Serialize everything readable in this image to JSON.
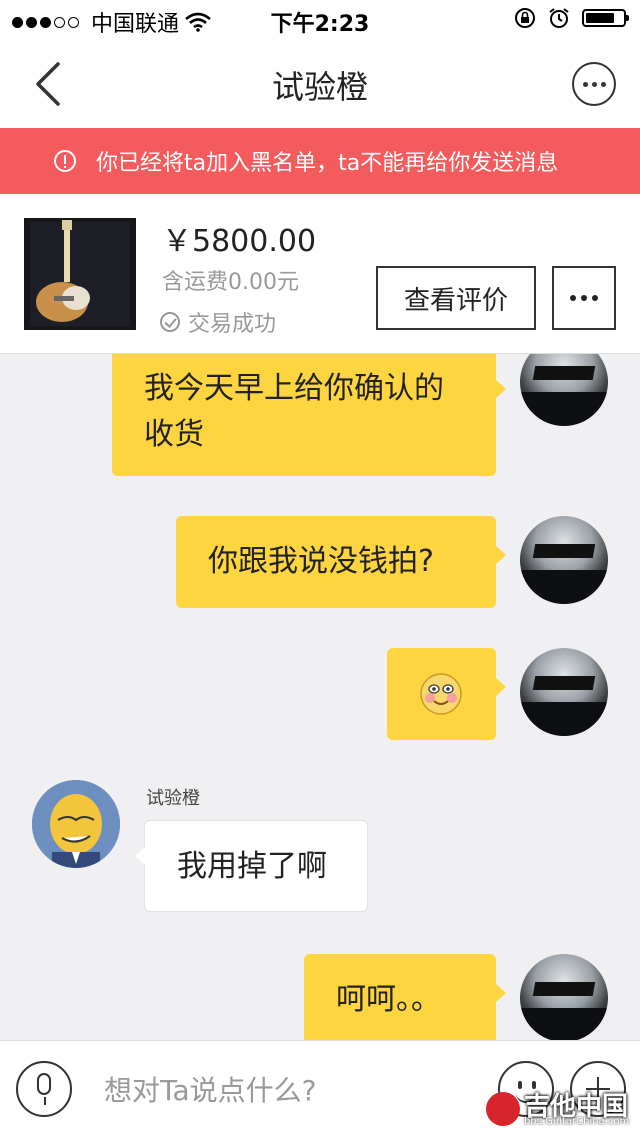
{
  "status_bar": {
    "carrier": "中国联通",
    "time": "下午2:23"
  },
  "nav": {
    "title": "试验橙"
  },
  "alert": {
    "text": "你已经将ta加入黑名单，ta不能再给你发送消息"
  },
  "order": {
    "price": "￥5800.00",
    "shipping": "含运费0.00元",
    "status": "交易成功",
    "review_button": "查看评价"
  },
  "messages": [
    {
      "from": "me",
      "text": "我今天早上给你确认的\n收货"
    },
    {
      "from": "me",
      "text": "你跟我说没钱拍?"
    },
    {
      "from": "me",
      "text": "😊"
    },
    {
      "from": "them",
      "sender": "试验橙",
      "text": "我用掉了啊"
    },
    {
      "from": "me",
      "text": "呵呵。。"
    }
  ],
  "input": {
    "placeholder": "想对Ta说点什么?"
  },
  "watermark": {
    "main": "吉他中国",
    "sub": "bbs.GuitarChina.com"
  },
  "colors": {
    "alert_bg": "#f35b5d",
    "my_bubble": "#fdd540",
    "page_bg": "#f0f0f2"
  }
}
